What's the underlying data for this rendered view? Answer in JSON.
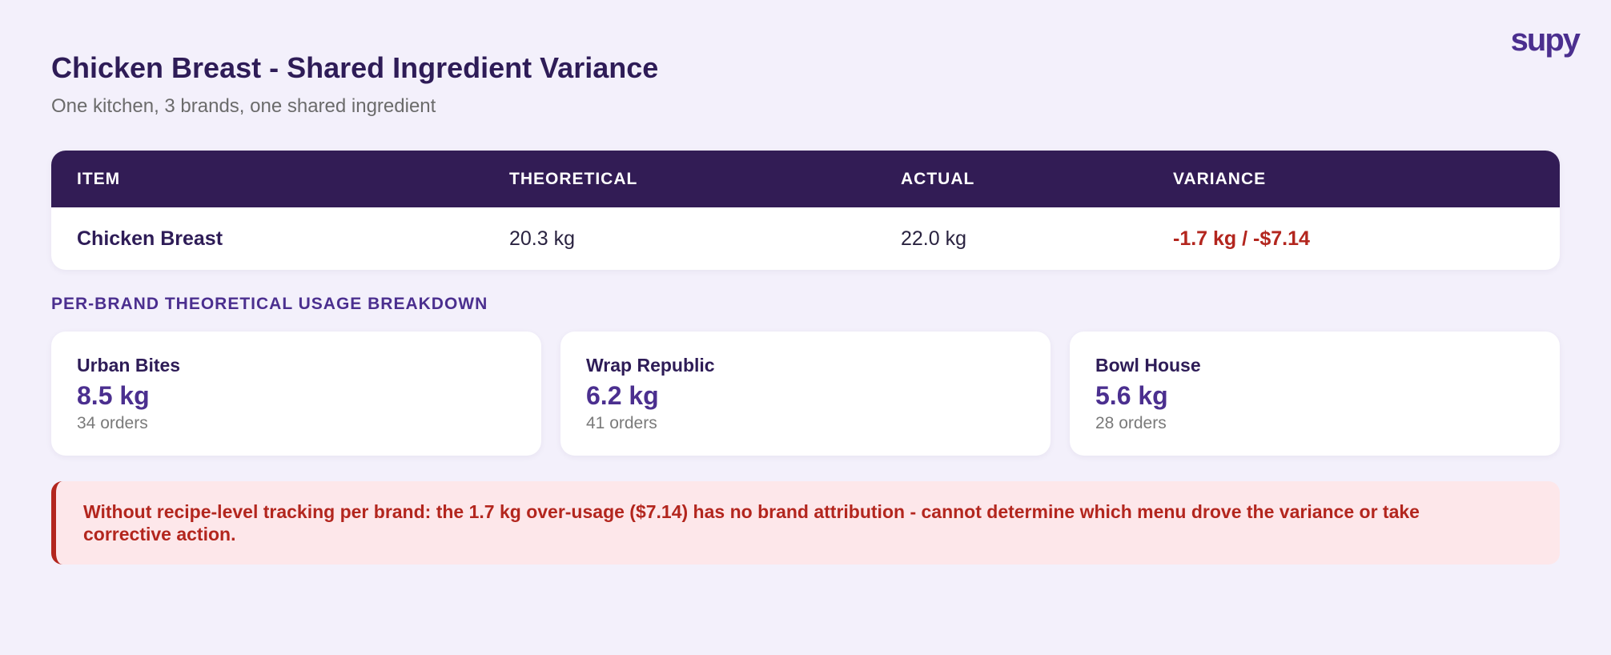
{
  "brand": {
    "logo_text": "supy"
  },
  "header": {
    "title": "Chicken Breast - Shared Ingredient Variance",
    "subtitle": "One kitchen, 3 brands, one shared ingredient"
  },
  "summary_table": {
    "columns": [
      "ITEM",
      "THEORETICAL",
      "ACTUAL",
      "VARIANCE"
    ],
    "rows": [
      [
        "Chicken Breast",
        "20.3 kg",
        "22.0 kg",
        "-1.7 kg / -$7.14"
      ]
    ]
  },
  "breakdown": {
    "section_label": "PER-BRAND THEORETICAL USAGE BREAKDOWN",
    "cards": [
      {
        "name": "Urban Bites",
        "qty": "8.5 kg",
        "orders": "34 orders"
      },
      {
        "name": "Wrap Republic",
        "qty": "6.2 kg",
        "orders": "41 orders"
      },
      {
        "name": "Bowl House",
        "qty": "5.6 kg",
        "orders": "28 orders"
      }
    ]
  },
  "alert": {
    "text": "Without recipe-level tracking per brand: the 1.7 kg over-usage ($7.14) has no brand attribution - cannot determine which menu drove the variance or take corrective action."
  },
  "colors": {
    "background": "#f3f0fb",
    "header_bg": "#321c55",
    "accent": "#4b2f8f",
    "negative": "#b3261e",
    "alert_bg": "#fde7ea"
  }
}
